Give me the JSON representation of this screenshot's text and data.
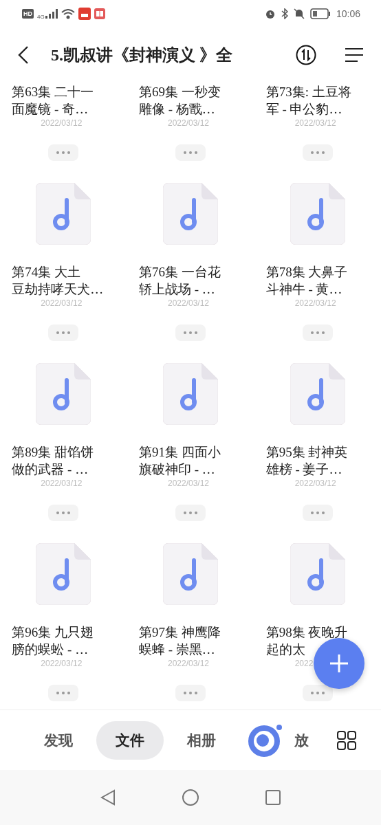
{
  "status_bar": {
    "hd": "HD",
    "network": "4G",
    "time": "10:06"
  },
  "header": {
    "title": "5.凯叔讲《封神演义 》全"
  },
  "files": [
    {
      "kind": "cut",
      "title_lines": [
        "第63集 二十一",
        "面魔镜 - 奇…"
      ],
      "date": "2022/03/12"
    },
    {
      "kind": "cut",
      "title_lines": [
        "第69集 一秒变",
        "雕像 - 杨戬…"
      ],
      "date": "2022/03/12"
    },
    {
      "kind": "cut",
      "title_lines": [
        "第73集: 土豆将",
        "军 - 申公豹…"
      ],
      "date": "2022/03/12"
    },
    {
      "kind": "file",
      "title_lines": [
        "第74集 大土",
        "豆劫持哮天犬…"
      ],
      "date": "2022/03/12"
    },
    {
      "kind": "file",
      "title_lines": [
        "第76集 一台花",
        "轿上战场 - …"
      ],
      "date": "2022/03/12"
    },
    {
      "kind": "file",
      "title_lines": [
        "第78集 大鼻子",
        "斗神牛 - 黄…"
      ],
      "date": "2022/03/12"
    },
    {
      "kind": "file",
      "title_lines": [
        "第89集 甜馅饼",
        "做的武器 - …"
      ],
      "date": "2022/03/12"
    },
    {
      "kind": "file",
      "title_lines": [
        "第91集 四面小",
        "旗破神印 - …"
      ],
      "date": "2022/03/12"
    },
    {
      "kind": "file",
      "title_lines": [
        "第95集 封神英",
        "雄榜 - 姜子…"
      ],
      "date": "2022/03/12"
    },
    {
      "kind": "file",
      "title_lines": [
        "第96集 九只翅",
        "膀的蜈蚣 - …"
      ],
      "date": "2022/03/12"
    },
    {
      "kind": "file",
      "title_lines": [
        "第97集 神鹰降",
        "蜈蜂 - 崇黑…"
      ],
      "date": "2022/03/12"
    },
    {
      "kind": "file",
      "title_lines": [
        "第98集 夜晚升",
        "起的太"
      ],
      "date": "2022"
    }
  ],
  "tabs": [
    {
      "kind": "text",
      "label": "发现",
      "selected": false
    },
    {
      "kind": "text",
      "label": "文件",
      "selected": true
    },
    {
      "kind": "text",
      "label": "相册",
      "selected": false
    },
    {
      "kind": "logo",
      "selected": false
    },
    {
      "kind": "text",
      "label": "放",
      "selected": false
    }
  ]
}
